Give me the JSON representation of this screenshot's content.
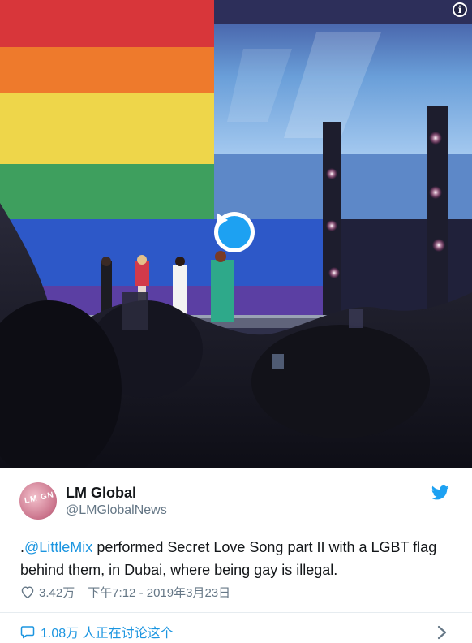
{
  "media": {
    "type": "video",
    "description_icon": "play-icon",
    "info_icon_label": "i",
    "flag_colors": [
      "#e23a30",
      "#f08a2c",
      "#f4df4a",
      "#3aa35a",
      "#2f55c9",
      "#6b3aa5"
    ],
    "accent": "#1da1f2"
  },
  "tweet": {
    "author_name": "LM Global",
    "author_handle": "@LMGlobalNews",
    "avatar_text": "LM GN",
    "text_prefix": ".",
    "mention": "@LittleMix",
    "text_rest": " performed Secret Love Song part II with a LGBT flag behind them, in Dubai, where being gay is illegal.",
    "likes": "3.42万",
    "timestamp": "下午7:12 - 2019年3月23日",
    "discussion": "1.08万 人正在讨论这个"
  },
  "colors": {
    "link": "#1b95e0",
    "secondary_text": "#657786",
    "primary_text": "#14171a",
    "divider": "#e6ecf0"
  }
}
